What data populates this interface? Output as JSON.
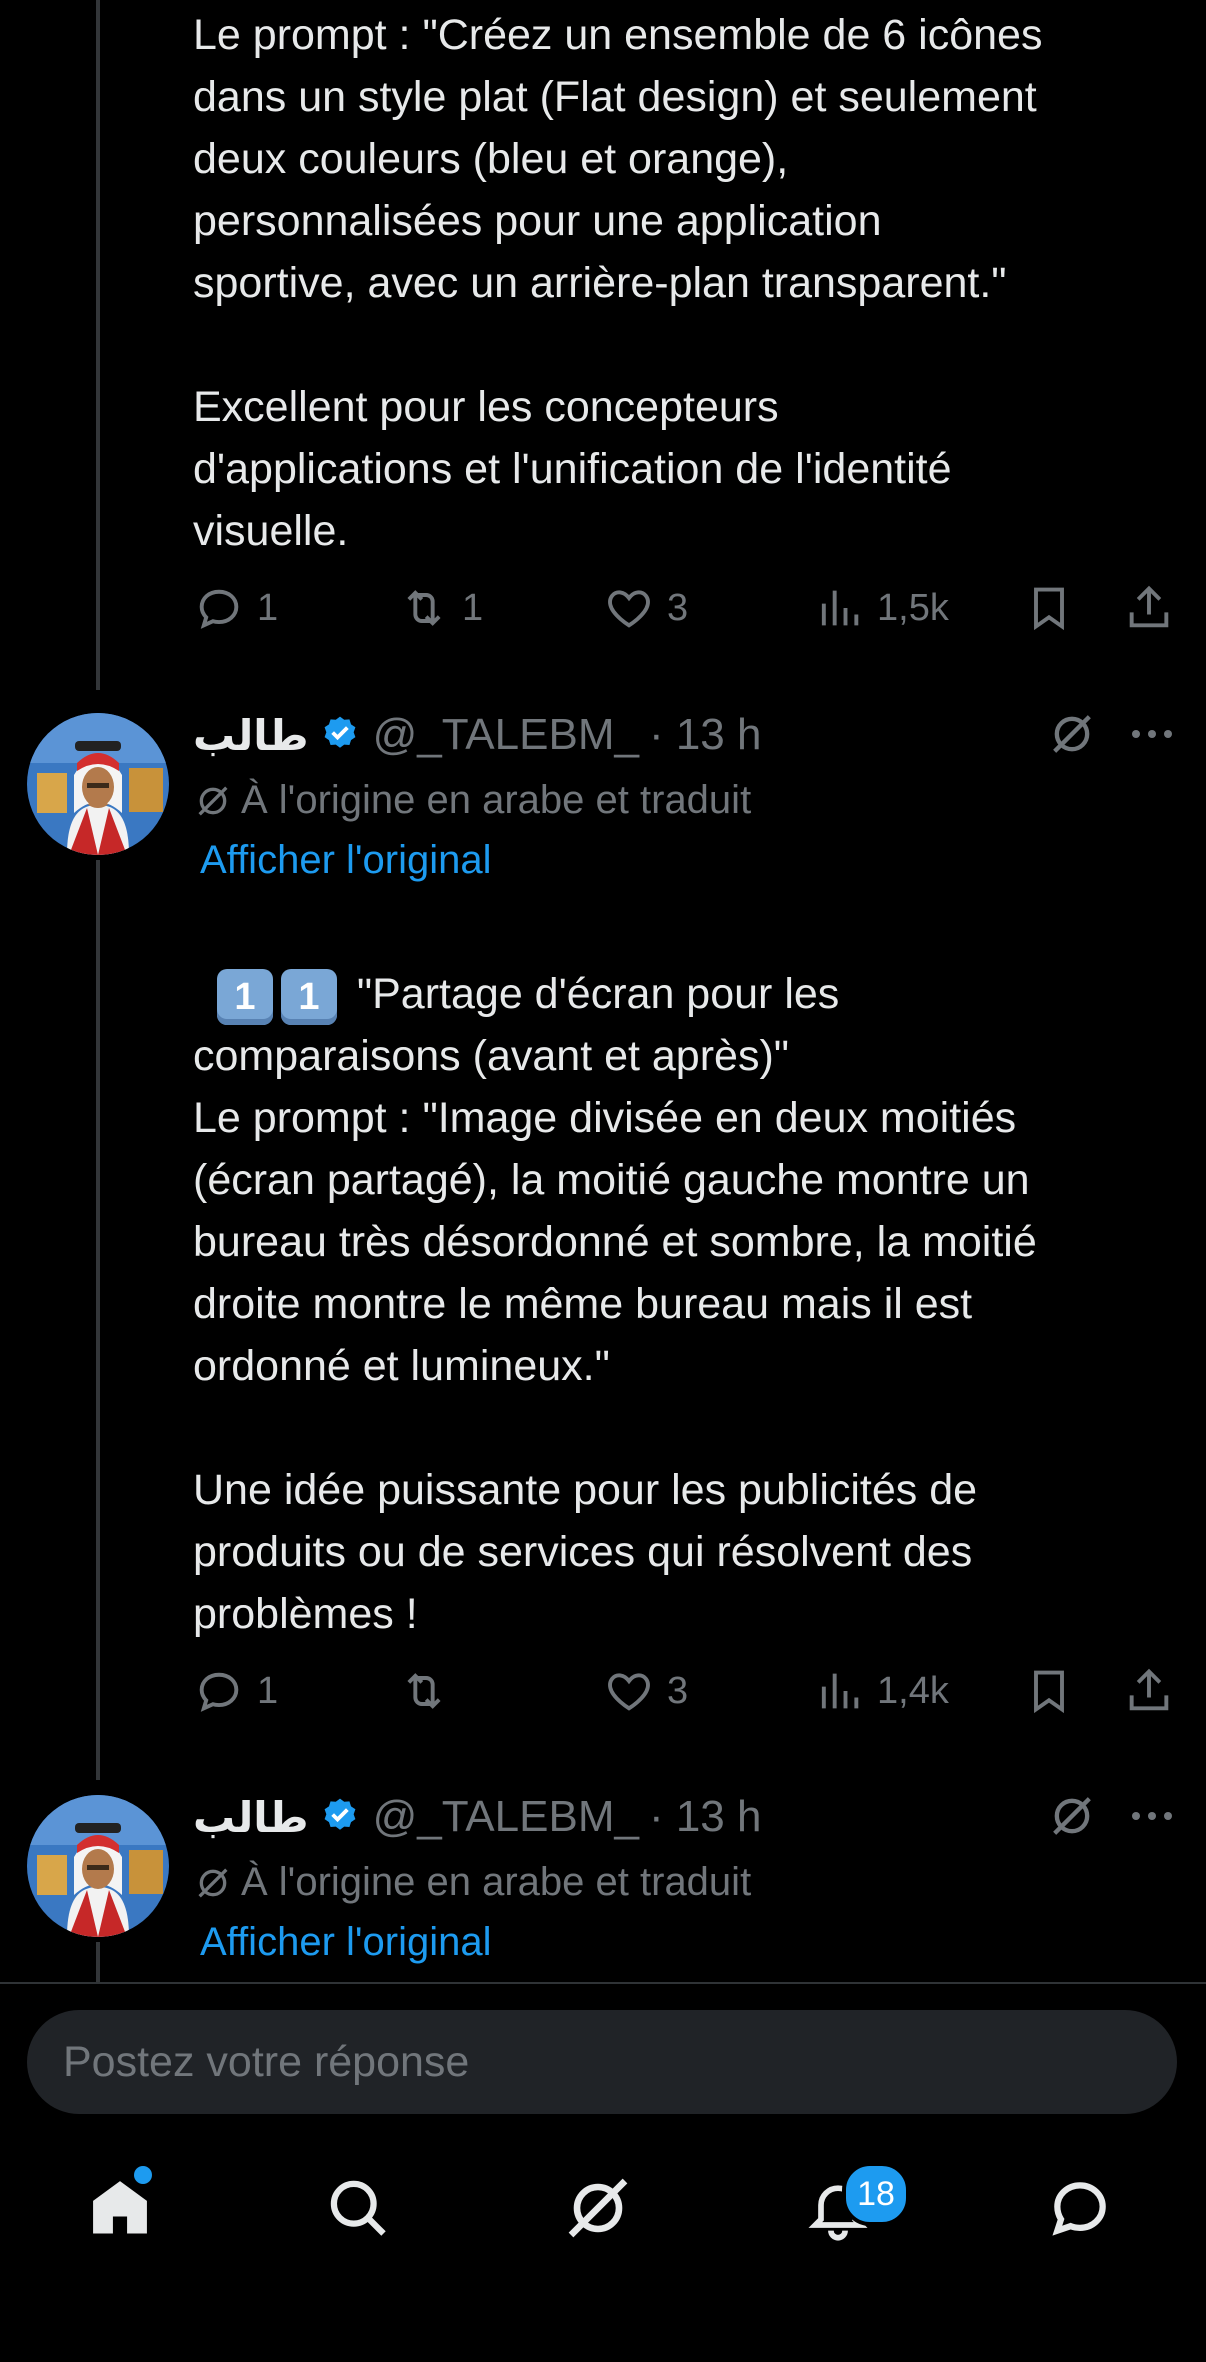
{
  "tweets": [
    {
      "text_top": "Le prompt : \"Créez un ensemble de 6 icônes\ndans un style plat (Flat design) et seulement\ndeux couleurs (bleu et orange),\npersonnalisées pour une application\nsportive, avec un arrière-plan transparent.\"\n\nExcellent pour les concepteurs\nd'applications et l'unification de l'identité\nvisuelle.",
      "replies": "1",
      "reposts": "1",
      "likes": "3",
      "views": "1,5k"
    },
    {
      "name": "طالب",
      "handle": "@_TALEBM_",
      "time": "· 13 h",
      "translated_note": "À l'origine en arabe et traduit",
      "show_original": "Afficher l'original",
      "keycaps": [
        "1",
        "1"
      ],
      "text_first": "\"Partage d'écran pour les\ncomparaisons (avant et après)\"",
      "text_rest": "Le prompt : \"Image divisée en deux moitiés\n(écran partagé), la moitié gauche montre un\nbureau très désordonné et sombre, la moitié\ndroite montre le même bureau mais il est\nordonné et lumineux.\"\n\nUne idée puissante pour les publicités de\nproduits ou de services qui résolvent des\nproblèmes !",
      "replies": "1",
      "reposts": "",
      "likes": "3",
      "views": "1,4k"
    },
    {
      "name": "طالب",
      "handle": "@_TALEBM_",
      "time": "· 13 h",
      "translated_note": "À l'origine en arabe et traduit",
      "show_original": "Afficher l'original"
    }
  ],
  "composer": {
    "placeholder": "Postez votre réponse"
  },
  "nav": {
    "items": [
      "home-icon",
      "search-icon",
      "grok-icon",
      "notifications-icon",
      "messages-icon"
    ],
    "notifications_badge": "18"
  },
  "colors": {
    "accent": "#1d9bf0",
    "muted": "#71767b",
    "text": "#e7e9ea",
    "background": "#000000"
  }
}
